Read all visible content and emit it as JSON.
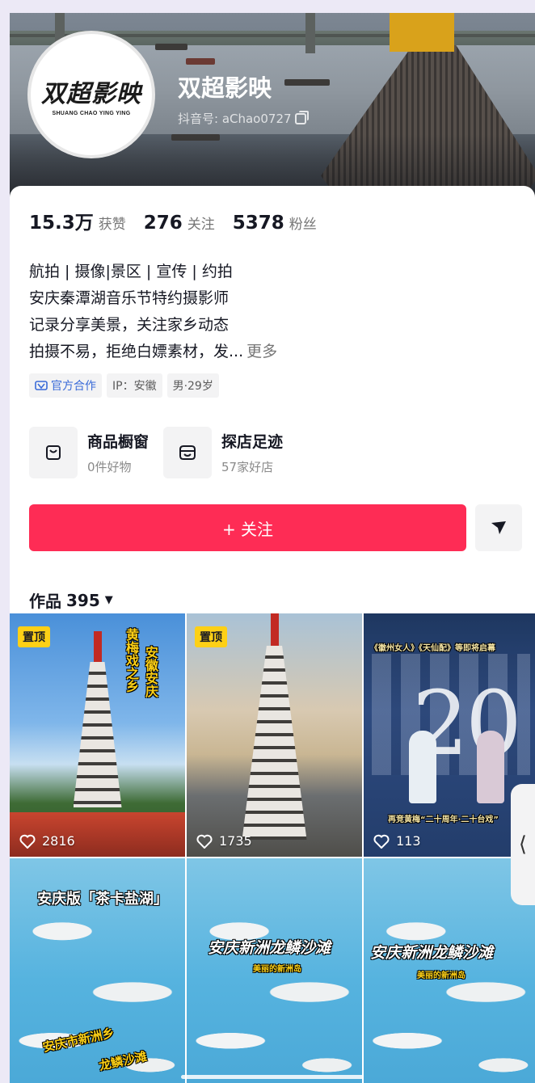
{
  "profile": {
    "avatar_logo": "双超影映",
    "avatar_logo_sub": "SHUANG CHAO YING YING",
    "nickname": "双超影映",
    "douyin_id": "抖音号: aChao0727"
  },
  "stats": {
    "likes_value": "15.3万",
    "likes_label": "获赞",
    "following_value": "276",
    "following_label": "关注",
    "fans_value": "5378",
    "fans_label": "粉丝"
  },
  "bio": {
    "line1": "航拍 | 摄像|景区 | 宣传 | 约拍",
    "line2": "安庆秦潭湖音乐节特约摄影师",
    "line3": "记录分享美景，关注家乡动态",
    "line4": "拍摄不易，拒绝白嫖素材，发...",
    "more": "更多"
  },
  "tags": [
    {
      "label": "官方合作",
      "icon": "official-icon"
    },
    {
      "label": "IP：安徽"
    },
    {
      "label": "男·29岁"
    }
  ],
  "services": [
    {
      "title": "商品橱窗",
      "sub": "0件好物",
      "icon": "shop-window-icon"
    },
    {
      "title": "探店足迹",
      "sub": "57家好店",
      "icon": "store-visit-icon"
    }
  ],
  "follow_button": "+ 关注",
  "works": {
    "label": "作品",
    "count": "395",
    "caret": "▼"
  },
  "videos": [
    {
      "pinned": "置顶",
      "likes": "2816",
      "caption": "黄梅戏之乡",
      "caption2": "安徽安庆"
    },
    {
      "pinned": "置顶",
      "likes": "1735"
    },
    {
      "likes": "113",
      "caption": "《徽州女人》《天仙配》等即将启幕",
      "caption2": "再竞黄梅“二十周年·二十台戏”",
      "big_text": "20"
    },
    {
      "caption": "安庆版「茶卡盐湖」",
      "caption2": "安庆市新洲乡",
      "caption3": "龙鳞沙滩"
    },
    {
      "caption": "安庆新洲龙鳞沙滩",
      "caption2": "美丽的新洲岛"
    },
    {
      "caption": "安庆新洲龙鳞沙滩",
      "caption2": "美丽的新洲岛"
    }
  ],
  "side_tab": "⟨",
  "colors": {
    "accent": "#fe2c55",
    "pin": "#fdd016",
    "official": "#3a6bd8"
  }
}
